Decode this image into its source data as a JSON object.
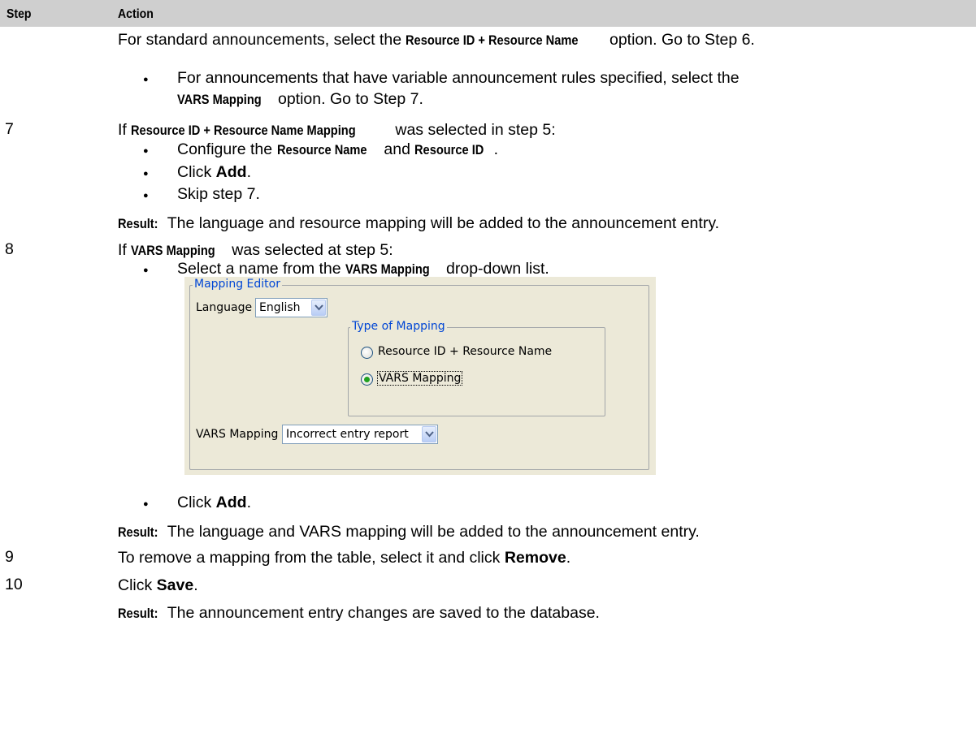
{
  "header": {
    "step": "Step",
    "action": "Action"
  },
  "line1": {
    "pre": "For standard announcements, select the ",
    "bold": "Resource ID + Resource Name",
    "post": " option. Go to Step 6."
  },
  "line2": {
    "pre": "For announcements that have variable announcement rules specified, select the",
    "bold": "VARS Mapping",
    "post": " option. Go to Step 7."
  },
  "step7": {
    "num": "7",
    "pre": "If ",
    "bold": "Resource ID + Resource Name Mapping",
    "post": " was selected in step 5:",
    "b1": {
      "pre": "Configure the ",
      "bold1": "Resource Name",
      "mid": " and ",
      "bold2": "Resource ID",
      "post": "."
    },
    "b2": {
      "pre": "Click ",
      "bold": "Add",
      "post": "."
    },
    "b3": "Skip step 7.",
    "result_label": "Result:",
    "result_text": " The language and resource mapping will be added to the announcement entry."
  },
  "step8": {
    "num": "8",
    "pre": "If ",
    "bold": "VARS Mapping",
    "post": " was selected at step 5:",
    "b1": {
      "pre": "Select a name from the ",
      "bold": "VARS Mapping",
      "post": " drop-down list."
    },
    "b2": {
      "pre": "Click ",
      "bold": "Add",
      "post": "."
    },
    "result_label": "Result:",
    "result_text": " The language and VARS mapping will be added to the announcement entry."
  },
  "step9": {
    "num": "9",
    "pre": "To remove a mapping from the table, select it and click ",
    "bold": "Remove",
    "post": "."
  },
  "step10": {
    "num": "10",
    "pre": "Click ",
    "bold": "Save",
    "post": ".",
    "result_label": "Result:",
    "result_text": " The announcement entry changes are saved to the database."
  },
  "editor": {
    "title": "Mapping Editor",
    "language_label": "Language",
    "language_value": "English",
    "type_title": "Type of Mapping",
    "option1": "Resource ID + Resource Name",
    "option2": "VARS Mapping",
    "selected_option": 2,
    "vars_label": "VARS Mapping",
    "vars_value": "Incorrect entry report"
  },
  "bullet_glyph": "●"
}
